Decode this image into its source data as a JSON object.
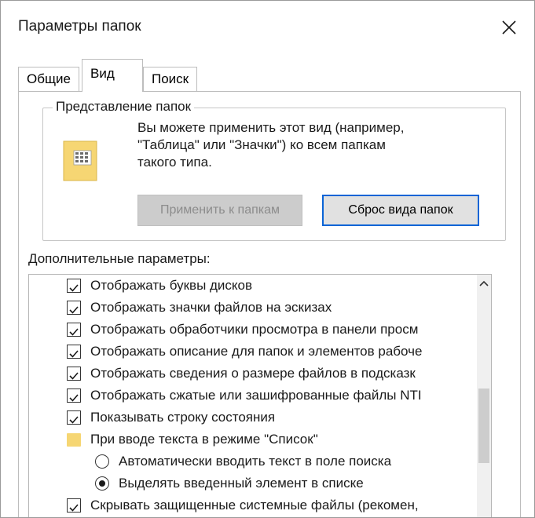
{
  "window": {
    "title": "Параметры папок",
    "close_symbol": "✕"
  },
  "tabs": [
    {
      "label": "Общие",
      "active": false
    },
    {
      "label": "Вид",
      "active": true
    },
    {
      "label": "Поиск",
      "active": false
    }
  ],
  "folder_views": {
    "legend": "Представление папок",
    "description_line1": "Вы можете применить этот вид (например,",
    "description_line2": "\"Таблица\" или \"Значки\") ко всем папкам",
    "description_line3": "такого типа.",
    "apply_button": "Применить к папкам",
    "reset_button": "Сброс вида папок",
    "icon": "folder-view-icon"
  },
  "advanced": {
    "label": "Дополнительные параметры:",
    "items": [
      {
        "type": "checkbox",
        "checked": true,
        "label": "Отображать буквы дисков"
      },
      {
        "type": "checkbox",
        "checked": true,
        "label": "Отображать значки файлов на эскизах"
      },
      {
        "type": "checkbox",
        "checked": true,
        "label": "Отображать обработчики просмотра в панели просм"
      },
      {
        "type": "checkbox",
        "checked": true,
        "label": "Отображать описание для папок и элементов рабоче"
      },
      {
        "type": "checkbox",
        "checked": true,
        "label": "Отображать сведения о размере файлов в подсказк"
      },
      {
        "type": "checkbox",
        "checked": true,
        "label": "Отображать сжатые или зашифрованные файлы NTI"
      },
      {
        "type": "checkbox",
        "checked": true,
        "label": "Показывать строку состояния"
      },
      {
        "type": "folder",
        "label": "При вводе текста в режиме \"Список\""
      },
      {
        "type": "radio",
        "checked": false,
        "label": "Автоматически вводить текст в поле поиска"
      },
      {
        "type": "radio",
        "checked": true,
        "label": "Выделять введенный элемент в списке"
      },
      {
        "type": "checkbox",
        "checked": true,
        "label": "Скрывать защищенные системные файлы (рекомен,"
      }
    ]
  },
  "colors": {
    "accent": "#0a64d6",
    "folder": "#f6d673"
  }
}
